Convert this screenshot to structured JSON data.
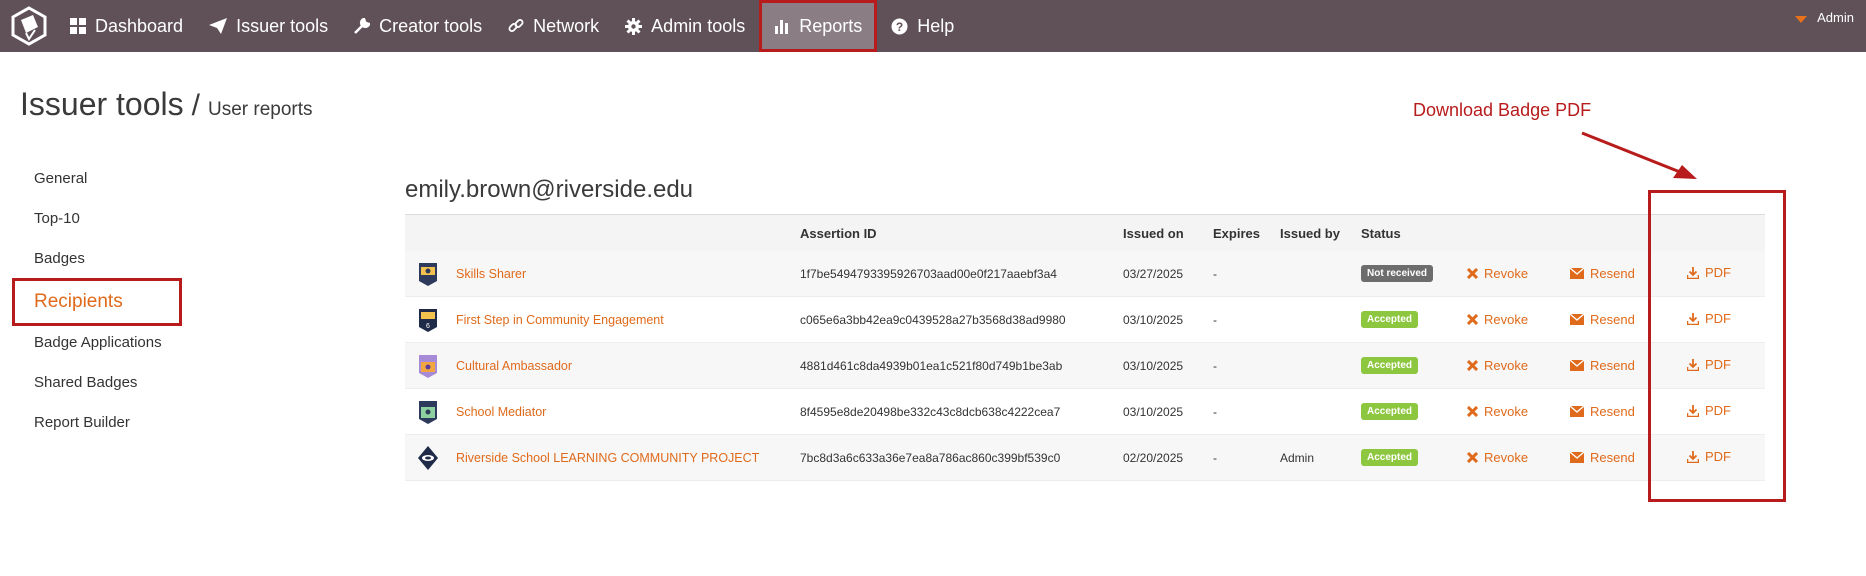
{
  "nav": {
    "items": [
      {
        "label": "Dashboard",
        "icon": "dashboard-icon"
      },
      {
        "label": "Issuer tools",
        "icon": "send-icon"
      },
      {
        "label": "Creator tools",
        "icon": "wrench-icon"
      },
      {
        "label": "Network",
        "icon": "link-icon"
      },
      {
        "label": "Admin tools",
        "icon": "gear-icon"
      },
      {
        "label": "Reports",
        "icon": "bar-chart-icon"
      },
      {
        "label": "Help",
        "icon": "help-icon"
      }
    ],
    "active": "Reports",
    "user": "Admin"
  },
  "page": {
    "title": "Issuer tools",
    "separator": "/",
    "subtitle": "User reports"
  },
  "sidebar": {
    "items": [
      {
        "label": "General"
      },
      {
        "label": "Top-10"
      },
      {
        "label": "Badges"
      },
      {
        "label": "Recipients"
      },
      {
        "label": "Badge Applications"
      },
      {
        "label": "Shared Badges"
      },
      {
        "label": "Report Builder"
      }
    ],
    "active": "Recipients"
  },
  "recipient": {
    "email": "emily.brown@riverside.edu"
  },
  "table": {
    "headers": {
      "badge": "",
      "assertion_id": "Assertion ID",
      "issued_on": "Issued on",
      "expires": "Expires",
      "issued_by": "Issued by",
      "status": "Status"
    },
    "rows": [
      {
        "badge": "Skills Sharer",
        "assertion_id": "1f7be5494793395926703aad00e0f217aaebf3a4",
        "issued_on": "03/27/2025",
        "expires": "-",
        "issued_by": "",
        "status": "Not received",
        "revoke": "Revoke",
        "resend": "Resend",
        "pdf": "PDF"
      },
      {
        "badge": "First Step in Community Engagement",
        "assertion_id": "c065e6a3bb42ea9c0439528a27b3568d38ad9980",
        "issued_on": "03/10/2025",
        "expires": "-",
        "issued_by": "",
        "status": "Accepted",
        "revoke": "Revoke",
        "resend": "Resend",
        "pdf": "PDF"
      },
      {
        "badge": "Cultural Ambassador",
        "assertion_id": "4881d461c8da4939b01ea1c521f80d749b1be3ab",
        "issued_on": "03/10/2025",
        "expires": "-",
        "issued_by": "",
        "status": "Accepted",
        "revoke": "Revoke",
        "resend": "Resend",
        "pdf": "PDF"
      },
      {
        "badge": "School Mediator",
        "assertion_id": "8f4595e8de20498be332c43c8dcb638c4222cea7",
        "issued_on": "03/10/2025",
        "expires": "-",
        "issued_by": "",
        "status": "Accepted",
        "revoke": "Revoke",
        "resend": "Resend",
        "pdf": "PDF"
      },
      {
        "badge": "Riverside School LEARNING COMMUNITY PROJECT",
        "assertion_id": "7bc8d3a6c633a36e7ea8a786ac860c399bf539c0",
        "issued_on": "02/20/2025",
        "expires": "-",
        "issued_by": "Admin",
        "status": "Accepted",
        "revoke": "Revoke",
        "resend": "Resend",
        "pdf": "PDF"
      }
    ]
  },
  "annotation": {
    "label": "Download Badge PDF"
  },
  "colors": {
    "topbar": "#5f5157",
    "accent": "#e06a1b",
    "highlight": "#b81b1b",
    "accepted": "#8dc63f",
    "not_received": "#6d6d6d"
  }
}
